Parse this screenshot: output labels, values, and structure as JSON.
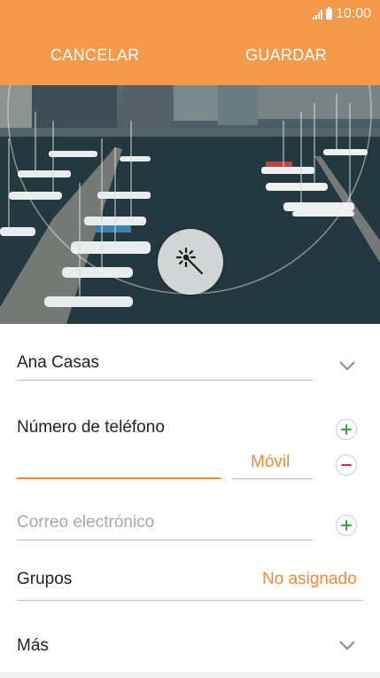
{
  "status": {
    "time": "10:00",
    "icons": [
      "signal-icon",
      "battery-icon"
    ]
  },
  "actions": {
    "cancel": "CANCELAR",
    "save": "GUARDAR"
  },
  "photo": {
    "button_icon": "magic-wand-icon"
  },
  "form": {
    "name_value": "Ana Casas",
    "phone_label": "Número de teléfono",
    "phone_value": "",
    "phone_type": "Móvil",
    "email_placeholder": "Correo electrónico",
    "groups_label": "Grupos",
    "groups_value": "No asignado",
    "more_label": "Más"
  },
  "colors": {
    "accent": "#f5994a",
    "accent_text": "#ef8b33",
    "add": "#3aa43a",
    "remove": "#d8263b"
  }
}
